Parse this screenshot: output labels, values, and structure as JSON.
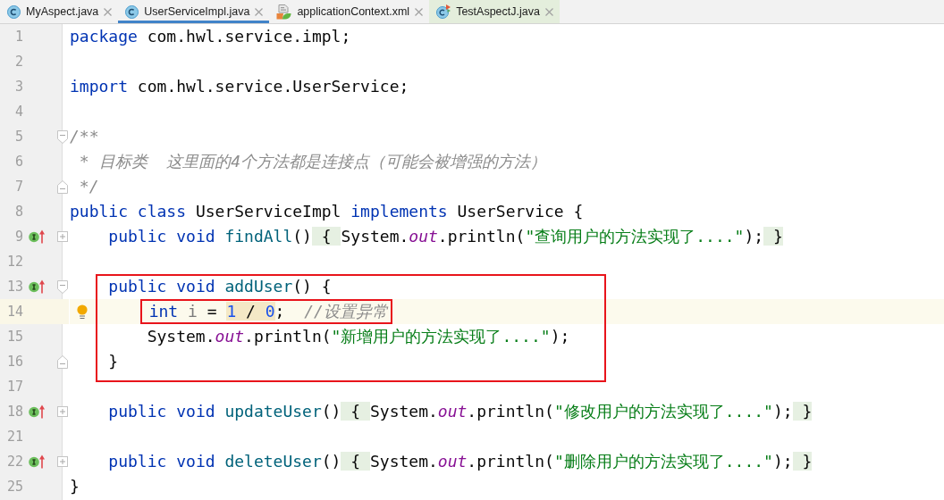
{
  "tabs": [
    {
      "label": "MyAspect.java",
      "kind": "class",
      "selected": false,
      "color": "#f2f2f2"
    },
    {
      "label": "UserServiceImpl.java",
      "kind": "class",
      "selected": true,
      "color": "#f2f2f2"
    },
    {
      "label": "applicationContext.xml",
      "kind": "xml",
      "selected": false,
      "color": "#f2f2f2"
    },
    {
      "label": "TestAspectJ.java",
      "kind": "test",
      "selected": false,
      "color": "#e4eedc"
    }
  ],
  "editor": {
    "lines": [
      {
        "number": "1",
        "current": false,
        "tokens": [
          {
            "kind": "keyword",
            "text": "package"
          },
          {
            "kind": "plain",
            "text": " com.hwl.service.impl;"
          }
        ]
      },
      {
        "number": "2",
        "current": false
      },
      {
        "number": "3",
        "current": false,
        "tokens": [
          {
            "kind": "keyword",
            "text": "import"
          },
          {
            "kind": "plain",
            "text": " com.hwl.service.UserService;"
          }
        ]
      },
      {
        "number": "4",
        "current": false
      },
      {
        "number": "5",
        "current": false,
        "gutter_icons": [
          {
            "kind": "fold-start"
          }
        ],
        "tokens": [
          {
            "kind": "comment",
            "text": "/**"
          }
        ]
      },
      {
        "number": "6",
        "current": false,
        "tokens": [
          {
            "kind": "comment",
            "text": " * 目标类  这里面的4个方法都是连接点（可能会被增强的方法）"
          }
        ]
      },
      {
        "number": "7",
        "current": false,
        "gutter_icons": [
          {
            "kind": "fold-end"
          }
        ],
        "tokens": [
          {
            "kind": "comment",
            "text": " */"
          }
        ]
      },
      {
        "number": "8",
        "current": false,
        "tokens": [
          {
            "kind": "keyword",
            "text": "public "
          },
          {
            "kind": "keyword",
            "text": "class"
          },
          {
            "kind": "plain",
            "text": " UserServiceImpl "
          },
          {
            "kind": "keyword",
            "text": "implements"
          },
          {
            "kind": "plain",
            "text": " UserService {"
          }
        ]
      },
      {
        "number": "9",
        "current": false,
        "gutter_icons": [
          {
            "kind": "implements"
          },
          {
            "kind": "fold-collapsed"
          }
        ],
        "tokens": [
          {
            "kind": "keyword",
            "text": "    public "
          },
          {
            "kind": "keyword",
            "text": "void "
          },
          {
            "kind": "method",
            "text": "findAll"
          },
          {
            "kind": "plain",
            "text": "()"
          },
          {
            "kind": "fold",
            "text": " { "
          },
          {
            "kind": "plain",
            "text": "System."
          },
          {
            "kind": "field",
            "text": "out"
          },
          {
            "kind": "plain",
            "text": ".println("
          },
          {
            "kind": "string",
            "text": "\"查询用户的方法实现了....\""
          },
          {
            "kind": "plain",
            "text": ");"
          },
          {
            "kind": "fold",
            "text": " }"
          }
        ]
      },
      {
        "number": "12",
        "current": false
      },
      {
        "number": "13",
        "current": false,
        "in_box": true,
        "gutter_icons": [
          {
            "kind": "implements"
          },
          {
            "kind": "fold-start"
          }
        ],
        "tokens": [
          {
            "kind": "keyword",
            "text": "    public "
          },
          {
            "kind": "keyword",
            "text": "void "
          },
          {
            "kind": "method",
            "text": "addUser"
          },
          {
            "kind": "plain",
            "text": "() {"
          }
        ]
      },
      {
        "number": "14",
        "current": true,
        "bulb": true,
        "in_box": true,
        "content_boxed": true,
        "tokens": [
          {
            "kind": "keyword",
            "text": "        int"
          },
          {
            "kind": "unused",
            "text": " i"
          },
          {
            "kind": "plain",
            "text": " = "
          },
          {
            "kind": "warning",
            "children": [
              {
                "kind": "number",
                "text": "1"
              },
              {
                "kind": "plain",
                "text": " / "
              },
              {
                "kind": "number",
                "text": "0"
              }
            ]
          },
          {
            "kind": "plain",
            "text": ";  "
          },
          {
            "kind": "comment",
            "text": "//设置异常"
          }
        ]
      },
      {
        "number": "15",
        "current": false,
        "in_box": true,
        "tokens": [
          {
            "kind": "plain",
            "text": "        System."
          },
          {
            "kind": "field",
            "text": "out"
          },
          {
            "kind": "plain",
            "text": ".println("
          },
          {
            "kind": "string",
            "text": "\"新增用户的方法实现了....\""
          },
          {
            "kind": "plain",
            "text": ");"
          }
        ]
      },
      {
        "number": "16",
        "current": false,
        "in_box": true,
        "gutter_icons": [
          {
            "kind": "fold-end"
          }
        ],
        "tokens": [
          {
            "kind": "plain",
            "text": "    }"
          }
        ]
      },
      {
        "number": "17",
        "current": false
      },
      {
        "number": "18",
        "current": false,
        "gutter_icons": [
          {
            "kind": "implements"
          },
          {
            "kind": "fold-collapsed"
          }
        ],
        "tokens": [
          {
            "kind": "keyword",
            "text": "    public "
          },
          {
            "kind": "keyword",
            "text": "void "
          },
          {
            "kind": "method",
            "text": "updateUser"
          },
          {
            "kind": "plain",
            "text": "()"
          },
          {
            "kind": "fold",
            "text": " { "
          },
          {
            "kind": "plain",
            "text": "System."
          },
          {
            "kind": "field",
            "text": "out"
          },
          {
            "kind": "plain",
            "text": ".println("
          },
          {
            "kind": "string",
            "text": "\"修改用户的方法实现了....\""
          },
          {
            "kind": "plain",
            "text": ");"
          },
          {
            "kind": "fold",
            "text": " }"
          }
        ]
      },
      {
        "number": "21",
        "current": false
      },
      {
        "number": "22",
        "current": false,
        "gutter_icons": [
          {
            "kind": "implements"
          },
          {
            "kind": "fold-collapsed"
          }
        ],
        "tokens": [
          {
            "kind": "keyword",
            "text": "    public "
          },
          {
            "kind": "keyword",
            "text": "void "
          },
          {
            "kind": "method",
            "text": "deleteUser"
          },
          {
            "kind": "plain",
            "text": "()"
          },
          {
            "kind": "fold",
            "text": " { "
          },
          {
            "kind": "plain",
            "text": "System."
          },
          {
            "kind": "field",
            "text": "out"
          },
          {
            "kind": "plain",
            "text": ".println("
          },
          {
            "kind": "string",
            "text": "\"删除用户的方法实现了....\""
          },
          {
            "kind": "plain",
            "text": ");"
          },
          {
            "kind": "fold",
            "text": " }"
          }
        ]
      },
      {
        "number": "25",
        "current": false,
        "tokens": [
          {
            "kind": "plain",
            "text": "}"
          }
        ]
      }
    ]
  }
}
